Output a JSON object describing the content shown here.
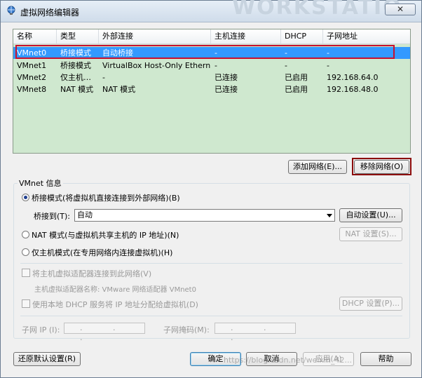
{
  "window": {
    "title": "虚拟网络编辑器",
    "close_label": "✕",
    "watermark": "WORKSTATIO"
  },
  "network_list": {
    "columns": [
      "名称",
      "类型",
      "外部连接",
      "主机连接",
      "DHCP",
      "子网地址"
    ],
    "rows": [
      [
        "VMnet0",
        "桥接模式",
        "自动桥接",
        "-",
        "-",
        "-"
      ],
      [
        "VMnet1",
        "桥接模式",
        "VirtualBox Host-Only Ethern…",
        "-",
        "-",
        "-"
      ],
      [
        "VMnet2",
        "仅主机…",
        "-",
        "已连接",
        "已启用",
        "192.168.64.0"
      ],
      [
        "VMnet8",
        "NAT 模式",
        "NAT 模式",
        "已连接",
        "已启用",
        "192.168.48.0"
      ]
    ],
    "selected_row": 0
  },
  "list_buttons": {
    "add": "添加网络(E)...",
    "remove": "移除网络(O)"
  },
  "vmnet_info": {
    "group_label": "VMnet 信息",
    "bridged_label": "桥接模式(将虚拟机直接连接到外部网络)(B)",
    "bridge_to_label": "桥接到(T):",
    "bridge_to_value": "自动",
    "auto_settings": "自动设置(U)...",
    "nat_label": "NAT 模式(与虚拟机共享主机的 IP 地址)(N)",
    "nat_settings": "NAT 设置(S)...",
    "hostonly_label": "仅主机模式(在专用网络内连接虚拟机)(H)",
    "connect_adapter_label": "将主机虚拟适配器连接到此网络(V)",
    "adapter_name_label": "主机虚拟适配器名称: VMware 网络适配器 VMnet0",
    "dhcp_label": "使用本地 DHCP 服务将 IP 地址分配给虚拟机(D)",
    "dhcp_settings": "DHCP 设置(P)...",
    "subnet_ip_label": "子网 IP (I):",
    "subnet_mask_label": "子网掩码(M):",
    "ip_placeholder": ". . ."
  },
  "footer": {
    "restore": "还原默认设置(R)",
    "ok": "确定",
    "cancel": "取消",
    "apply": "应用(A)",
    "help": "帮助"
  },
  "overlay_url": "https://blog.csdn.net/weixin_42..."
}
